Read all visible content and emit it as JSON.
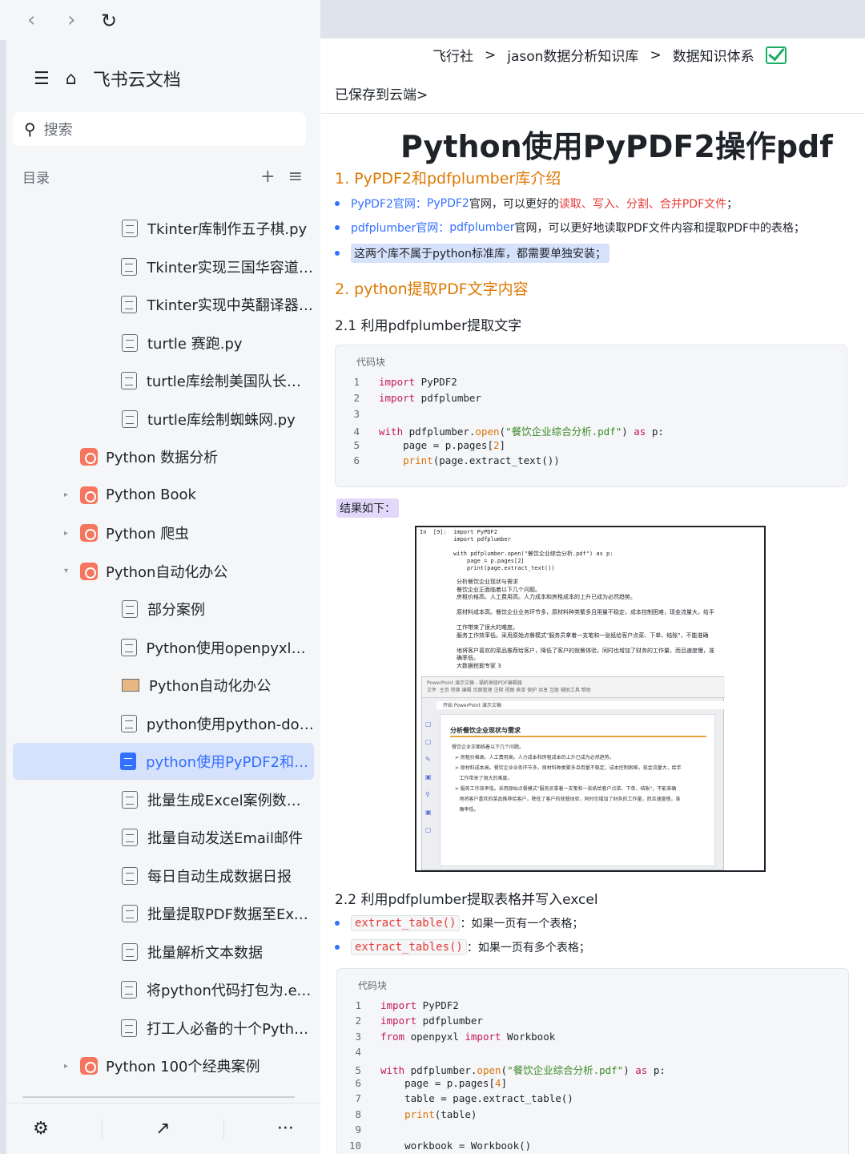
{
  "browser": {
    "back": "‹",
    "forward": "›",
    "reload": "↻"
  },
  "sidebar": {
    "app_title": "飞书云文档",
    "search_placeholder": "搜索",
    "toc_label": "目录",
    "items": [
      {
        "label": "Tkinter库制作五子棋.py",
        "type": "doc"
      },
      {
        "label": "Tkinter实现三国华容道.py",
        "type": "doc"
      },
      {
        "label": "Tkinter实现中英翻译器.py",
        "type": "doc"
      },
      {
        "label": "turtle 赛跑.py",
        "type": "doc"
      },
      {
        "label": "turtle库绘制美国队长的盾...",
        "type": "doc"
      },
      {
        "label": "turtle库绘制蜘蛛网.py",
        "type": "doc"
      },
      {
        "label": "Python 数据分析",
        "type": "folder"
      },
      {
        "label": "Python Book",
        "type": "folder"
      },
      {
        "label": "Python 爬虫",
        "type": "folder"
      },
      {
        "label": "Python自动化办公",
        "type": "folder"
      },
      {
        "label": "部分案例",
        "type": "doc"
      },
      {
        "label": "Python使用openpyxl操作...",
        "type": "doc"
      },
      {
        "label": "Python自动化办公",
        "type": "slide"
      },
      {
        "label": "python使用python-docx...",
        "type": "doc"
      },
      {
        "label": "python使用PyPDF2和pdfp...",
        "type": "doc"
      },
      {
        "label": "批量生成Excel案例数据集",
        "type": "doc"
      },
      {
        "label": "批量自动发送Email邮件",
        "type": "doc"
      },
      {
        "label": "每日自动生成数据日报",
        "type": "doc"
      },
      {
        "label": "批量提取PDF数据至Excel",
        "type": "doc"
      },
      {
        "label": "批量解析文本数据",
        "type": "doc"
      },
      {
        "label": "将python代码打包为.exe...",
        "type": "doc"
      },
      {
        "label": "打工人必备的十个Python...",
        "type": "doc"
      },
      {
        "label": "Python 100个经典案例",
        "type": "folder"
      }
    ],
    "bottom": {
      "settings": "⚙",
      "share": "↗",
      "more": "···"
    }
  },
  "main": {
    "breadcrumb": [
      "飞行社",
      ">",
      "jason数据分析知识库",
      ">",
      "数据知识体系"
    ],
    "saved": "已保存到云端>",
    "title": "Python使用PyPDF2操作pdf",
    "h1_1": "1. PyPDF2和pdfplumber库介绍",
    "b1": {
      "a": "PyPDF2官网：",
      "b": "PyPDF2",
      "c": "官网，可以更好的",
      "d": "读取、写入、分割、合并PDF文件",
      "e": "；"
    },
    "b2": {
      "a": "pdfplumber官网：",
      "b": "pdfplumber",
      "c": "官网，可以更好地读取PDF文件内容和提取PDF中的表格；"
    },
    "b3": "这两个库不属于python标准库，都需要单独安装；",
    "h1_2": "2. python提取PDF文字内容",
    "h2_1": "2.1 利用pdfplumber提取文字",
    "code_caption": "代码块",
    "result_label": "结果如下：",
    "h2_2": "2.2 利用pdfplumber提取表格并写入excel",
    "b4": {
      "code": "extract_table()",
      "text": "：如果一页有一个表格；"
    },
    "b5": {
      "code": "extract_tables()",
      "text": "：如果一页有多个表格；"
    }
  },
  "screenshot": {
    "code": "In  [9]:  import PyPDF2\n          import pdfplumber\n\n          with pdfplumber.open(\"餐饮企业综合分析.pdf\") as p:\n              page = p.pages[2]\n              print(page.extract_text())",
    "output": "分析餐饮企业现状与需求\n餐饮企业正面临着以下几个问题。\n房租价格高、人工费用高。人力成本和房租成本的上升已成为必然趋势。\n\n原材料成本高。餐饮企业业务环节多，原材料种类繁多且用量不稳定，成本控制困难，现金流量大，给手\n\n工作带来了很大的难度。\n服务工作效率低。采用原始点餐模式\"服务员拿着一支笔和一张纸给客户点菜、下单、结账\"，不能准确\n\n地将客户喜欢的菜品推荐给客户，降低了客户的就餐体验，同时也增加了财务的工作量，而且速度慢，准\n确率低。\n大数据挖掘专家 3",
    "ppt_ribbon": "PowerPoint 演示文稿 - 福昕高级PDF编辑器\n文件  主页 转换 编辑 页面管理 注释 视图 表单 保护 共享 互联 辅助工具 帮助",
    "ppt_tab": "开始                      PowerPoint 演示文稿",
    "slide_title": "分析餐饮企业现状与需求",
    "slide_body": "餐饮企业正面临着以下几个问题。\n  > 房租价格高、人工费用高。人力成本和房租成本的上升已成为必然趋势。\n  > 原材料成本高。餐饮企业业务环节多，原材料种类繁多且用量不稳定，成本控制困难，现金流量大，给手\n     工作带来了很大的难度。\n  > 服务工作效率低。采用原始点餐模式\"服务员拿着一支笔和一张纸给客户点菜、下单、结账\"，不能准确\n     地将客户喜欢的菜品推荐给客户，降低了客户的就餐体验，同时也增加了财务的工作量，而且速度慢，准\n     确率低。"
  }
}
